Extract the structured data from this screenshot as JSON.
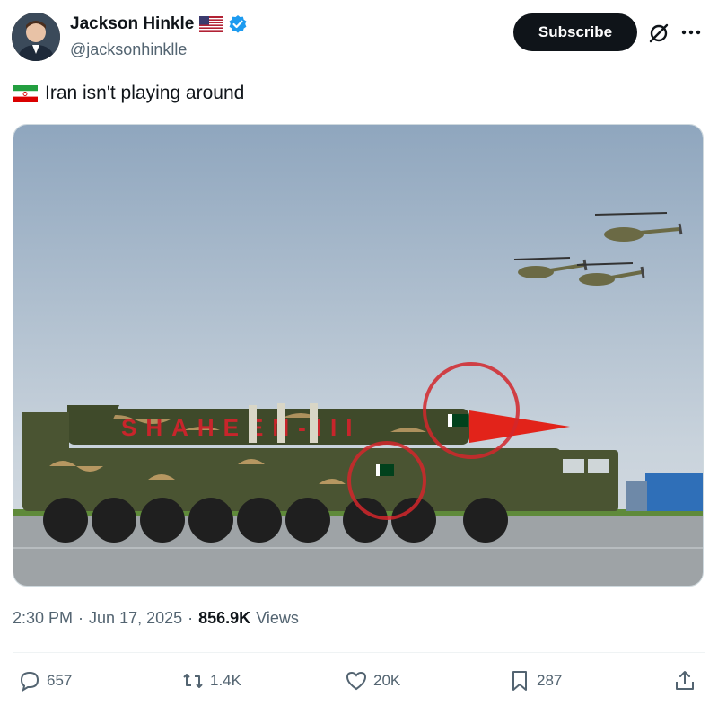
{
  "author": {
    "name": "Jackson Hinkle",
    "flag": "🇺🇸",
    "verified": true,
    "handle": "@jacksonhinklle",
    "avatar": "avatar-photo"
  },
  "header": {
    "subscribe_label": "Subscribe",
    "grok_icon": "grok-icon",
    "more_icon": "more-icon"
  },
  "post": {
    "flag": "🇮🇷",
    "text": "Iran isn't playing around"
  },
  "media": {
    "missile_lettering": "SHAHEEN-III"
  },
  "meta": {
    "time": "2:30 PM",
    "date": "Jun 17, 2025",
    "views": "856.9K",
    "views_label": "Views"
  },
  "actions": {
    "replies": "657",
    "reposts": "1.4K",
    "likes": "20K",
    "bookmarks": "287"
  },
  "colors": {
    "accent": "#1d9bf0",
    "text": "#0f1419",
    "secondary": "#536471"
  }
}
